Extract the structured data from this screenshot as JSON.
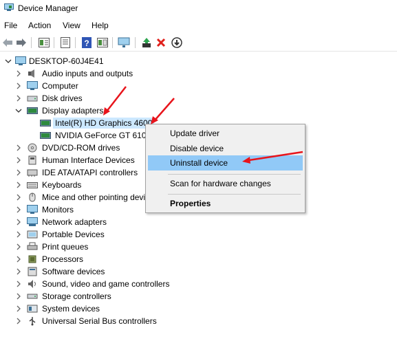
{
  "window": {
    "title": "Device Manager"
  },
  "menu": [
    "File",
    "Action",
    "View",
    "Help"
  ],
  "toolbar": {
    "icons": [
      "back-arrow-icon",
      "forward-arrow-icon",
      "properties-icon",
      "update-icon",
      "help-icon",
      "view-icon",
      "monitor-scan-icon",
      "add-driver-icon",
      "remove-icon",
      "download-icon"
    ]
  },
  "tree": {
    "root": "DESKTOP-60J4E41",
    "categories": [
      {
        "label": "Audio inputs and outputs",
        "icon": "speaker-icon",
        "expanded": false
      },
      {
        "label": "Computer",
        "icon": "computer-icon",
        "expanded": false
      },
      {
        "label": "Disk drives",
        "icon": "disk-icon",
        "expanded": false
      },
      {
        "label": "Display adapters",
        "icon": "display-adapter-icon",
        "expanded": true,
        "children": [
          {
            "label": "Intel(R) HD Graphics 4600",
            "selected": true
          },
          {
            "label": "NVIDIA GeForce GT 610",
            "selected": false
          }
        ]
      },
      {
        "label": "DVD/CD-ROM drives",
        "icon": "dvd-icon",
        "expanded": false
      },
      {
        "label": "Human Interface Devices",
        "icon": "hid-icon",
        "expanded": false
      },
      {
        "label": "IDE ATA/ATAPI controllers",
        "icon": "ide-icon",
        "expanded": false
      },
      {
        "label": "Keyboards",
        "icon": "keyboard-icon",
        "expanded": false
      },
      {
        "label": "Mice and other pointing devices",
        "icon": "mouse-icon",
        "expanded": false
      },
      {
        "label": "Monitors",
        "icon": "monitor-icon",
        "expanded": false
      },
      {
        "label": "Network adapters",
        "icon": "network-icon",
        "expanded": false
      },
      {
        "label": "Portable Devices",
        "icon": "portable-icon",
        "expanded": false
      },
      {
        "label": "Print queues",
        "icon": "printer-icon",
        "expanded": false
      },
      {
        "label": "Processors",
        "icon": "processor-icon",
        "expanded": false
      },
      {
        "label": "Software devices",
        "icon": "software-icon",
        "expanded": false
      },
      {
        "label": "Sound, video and game controllers",
        "icon": "sound-icon",
        "expanded": false
      },
      {
        "label": "Storage controllers",
        "icon": "storage-icon",
        "expanded": false
      },
      {
        "label": "System devices",
        "icon": "system-icon",
        "expanded": false
      },
      {
        "label": "Universal Serial Bus controllers",
        "icon": "usb-icon",
        "expanded": false
      }
    ]
  },
  "context_menu": {
    "items": [
      {
        "label": "Update driver",
        "highlighted": false,
        "bold": false
      },
      {
        "label": "Disable device",
        "highlighted": false,
        "bold": false
      },
      {
        "label": "Uninstall device",
        "highlighted": true,
        "bold": false
      },
      {
        "label": "Scan for hardware changes",
        "highlighted": false,
        "bold": false
      },
      {
        "label": "Properties",
        "highlighted": false,
        "bold": true
      }
    ]
  },
  "colors": {
    "highlight": "#91c9f7",
    "selection": "#cce8ff",
    "annotation_arrow": "#e8141b"
  }
}
